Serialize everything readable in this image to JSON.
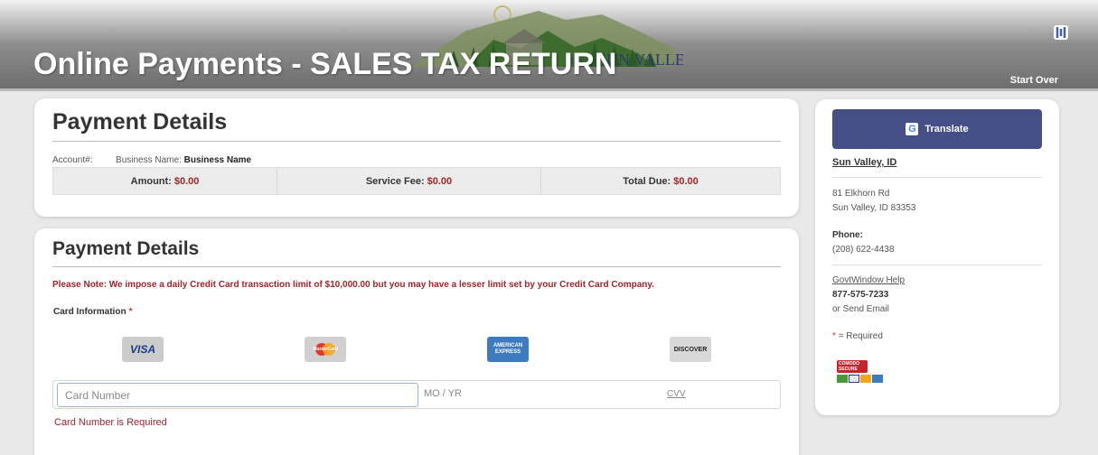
{
  "header": {
    "title": "Online Payments - SALES TAX RETURN",
    "logo_text": "City of SUN VALLEY",
    "start_over": "Start Over"
  },
  "summary": {
    "heading": "Payment Details",
    "account_label": "Account#:",
    "business_label": "Business Name:",
    "business_value": "Business Name",
    "amount_label": "Amount:",
    "amount_value": "$0.00",
    "fee_label": "Service Fee:",
    "fee_value": "$0.00",
    "total_label": "Total Due:",
    "total_value": "$0.00"
  },
  "payment": {
    "heading": "Payment Details",
    "note": "Please Note: We impose a daily Credit Card transaction limit of $10,000.00 but you may have a lesser limit set by your Credit Card Company.",
    "card_info_label": "Card Information",
    "required_mark": "*",
    "brands": {
      "visa": "VISA",
      "mastercard": "MasterCard",
      "amex": "AMERICAN EXPRESS",
      "discover": "DISCOVER"
    },
    "card_number_placeholder": "Card Number",
    "mo_yr": "MO / YR",
    "cvv": "CVV",
    "error": "Card Number is Required"
  },
  "sidebar": {
    "translate_label": "Translate",
    "location": "Sun Valley, ID",
    "address_line1": "81 Elkhorn Rd",
    "address_line2": "Sun Valley, ID 83353",
    "phone_label": "Phone:",
    "phone_value": "(208) 622-4438",
    "help_link": "GovtWindow Help",
    "help_phone": "877-575-7233",
    "send_email": "or Send Email",
    "required_star": "*",
    "required_note": "= Required",
    "comodo": "COMODO SECURE"
  },
  "colors": {
    "accent_red": "#a0262a",
    "translate_bg": "#454e86"
  }
}
